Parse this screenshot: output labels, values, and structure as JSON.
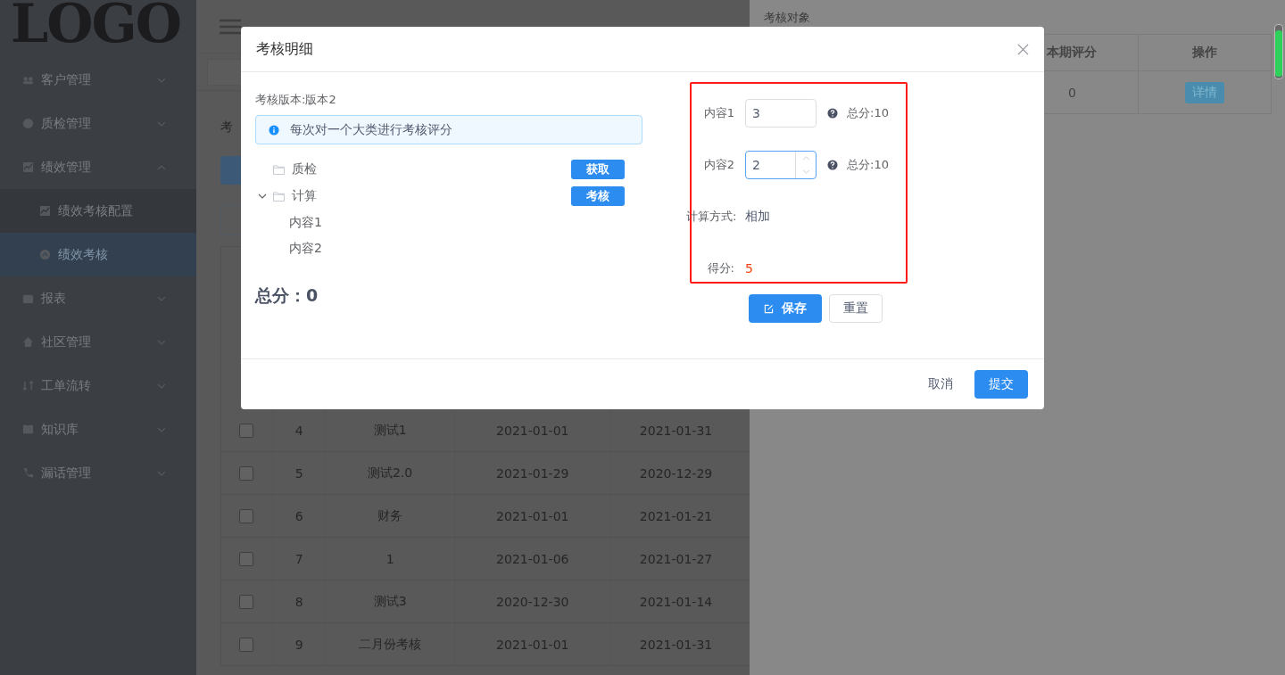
{
  "sidebar": {
    "logo": "LOGO",
    "items": [
      {
        "label": "客户管理",
        "expanded": false
      },
      {
        "label": "质检管理",
        "expanded": false
      },
      {
        "label": "绩效管理",
        "expanded": true,
        "children": [
          {
            "label": "绩效考核配置",
            "selected": false
          },
          {
            "label": "绩效考核",
            "selected": true
          }
        ]
      },
      {
        "label": "报表",
        "expanded": false
      },
      {
        "label": "社区管理",
        "expanded": false
      },
      {
        "label": "工单流转",
        "expanded": false
      },
      {
        "label": "知识库",
        "expanded": false
      },
      {
        "label": "漏话管理",
        "expanded": false
      }
    ]
  },
  "main": {
    "label": "考",
    "rows": [
      {
        "checked": false,
        "index": "4",
        "name": "测试1",
        "start": "2021-01-01",
        "end": "2021-01-31"
      },
      {
        "checked": false,
        "index": "5",
        "name": "测试2.0",
        "start": "2021-01-29",
        "end": "2020-12-29"
      },
      {
        "checked": false,
        "index": "6",
        "name": "财务",
        "start": "2021-01-01",
        "end": "2021-01-21"
      },
      {
        "checked": false,
        "index": "7",
        "name": "1",
        "start": "2021-01-06",
        "end": "2021-01-27"
      },
      {
        "checked": false,
        "index": "8",
        "name": "测试3",
        "start": "2020-12-30",
        "end": "2021-01-14"
      },
      {
        "checked": false,
        "index": "9",
        "name": "二月份考核",
        "start": "2021-01-01",
        "end": "2021-01-31"
      }
    ]
  },
  "drawer": {
    "title": "考核对象",
    "columns": [
      "本期评分",
      "操作"
    ],
    "rows": [
      {
        "score": "0",
        "action": "详情"
      }
    ]
  },
  "dialog": {
    "title": "考核明细",
    "version": "考核版本:版本2",
    "notice": "每次对一个大类进行考核评分",
    "tree": [
      {
        "label": "质检",
        "action": "获取"
      },
      {
        "label": "计算",
        "action": "考核",
        "expanded": true,
        "children": [
          {
            "label": "内容1"
          },
          {
            "label": "内容2"
          }
        ]
      }
    ],
    "total": "总分：0",
    "form": [
      {
        "kind": "number",
        "label": "内容1",
        "value": "3",
        "focused": false,
        "hint": "总分:10"
      },
      {
        "kind": "number",
        "label": "内容2",
        "value": "2",
        "focused": true,
        "hint": "总分:10"
      },
      {
        "kind": "text",
        "label": "计算方式:",
        "value": "相加"
      },
      {
        "kind": "score",
        "label": "得分:",
        "value": "5"
      }
    ],
    "save": "保存",
    "reset": "重置",
    "cancel": "取消",
    "submit": "提交"
  }
}
